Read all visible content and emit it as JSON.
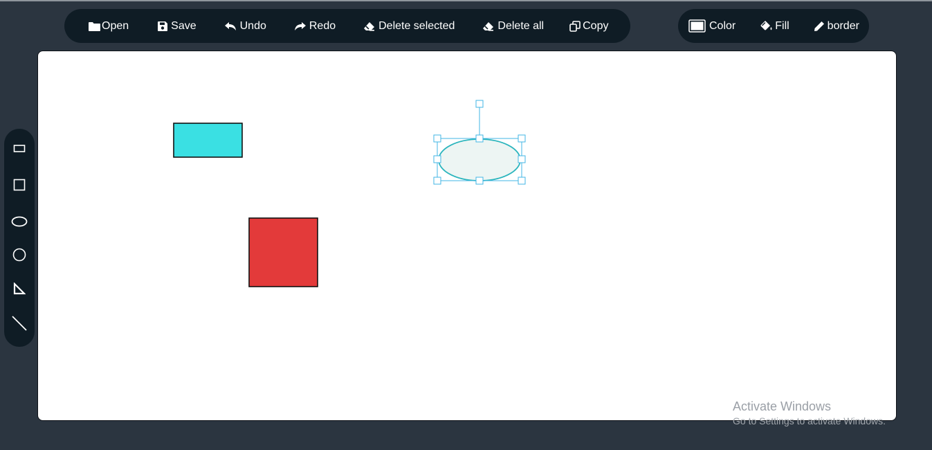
{
  "toolbar": {
    "open_label": "Open",
    "save_label": "Save",
    "undo_label": "Undo",
    "redo_label": "Redo",
    "delete_selected_label": "Delete selected",
    "delete_all_label": "Delete all",
    "copy_label": "Copy"
  },
  "style_toolbar": {
    "color_label": "Color",
    "fill_label": "Fill",
    "border_label": "border"
  },
  "sidebar": {
    "tools": [
      "rectangle-tool",
      "square-tool",
      "ellipse-tool",
      "circle-tool",
      "triangle-tool",
      "line-tool"
    ]
  },
  "canvas": {
    "shapes": [
      {
        "type": "rectangle",
        "fill": "#3ae0e3",
        "stroke": "#111111"
      },
      {
        "type": "square",
        "fill": "#e33a3a",
        "stroke": "#111111"
      },
      {
        "type": "ellipse",
        "fill": "#edf5f3",
        "stroke": "#2bb5bd",
        "selected": true
      }
    ],
    "selection_color": "#42b6e4"
  },
  "colors": {
    "background": "#2b3540",
    "toolbar": "#0f1c25",
    "canvas": "#ffffff"
  },
  "watermark": {
    "title": "Activate Windows",
    "subtitle": "Go to Settings to activate Windows."
  }
}
